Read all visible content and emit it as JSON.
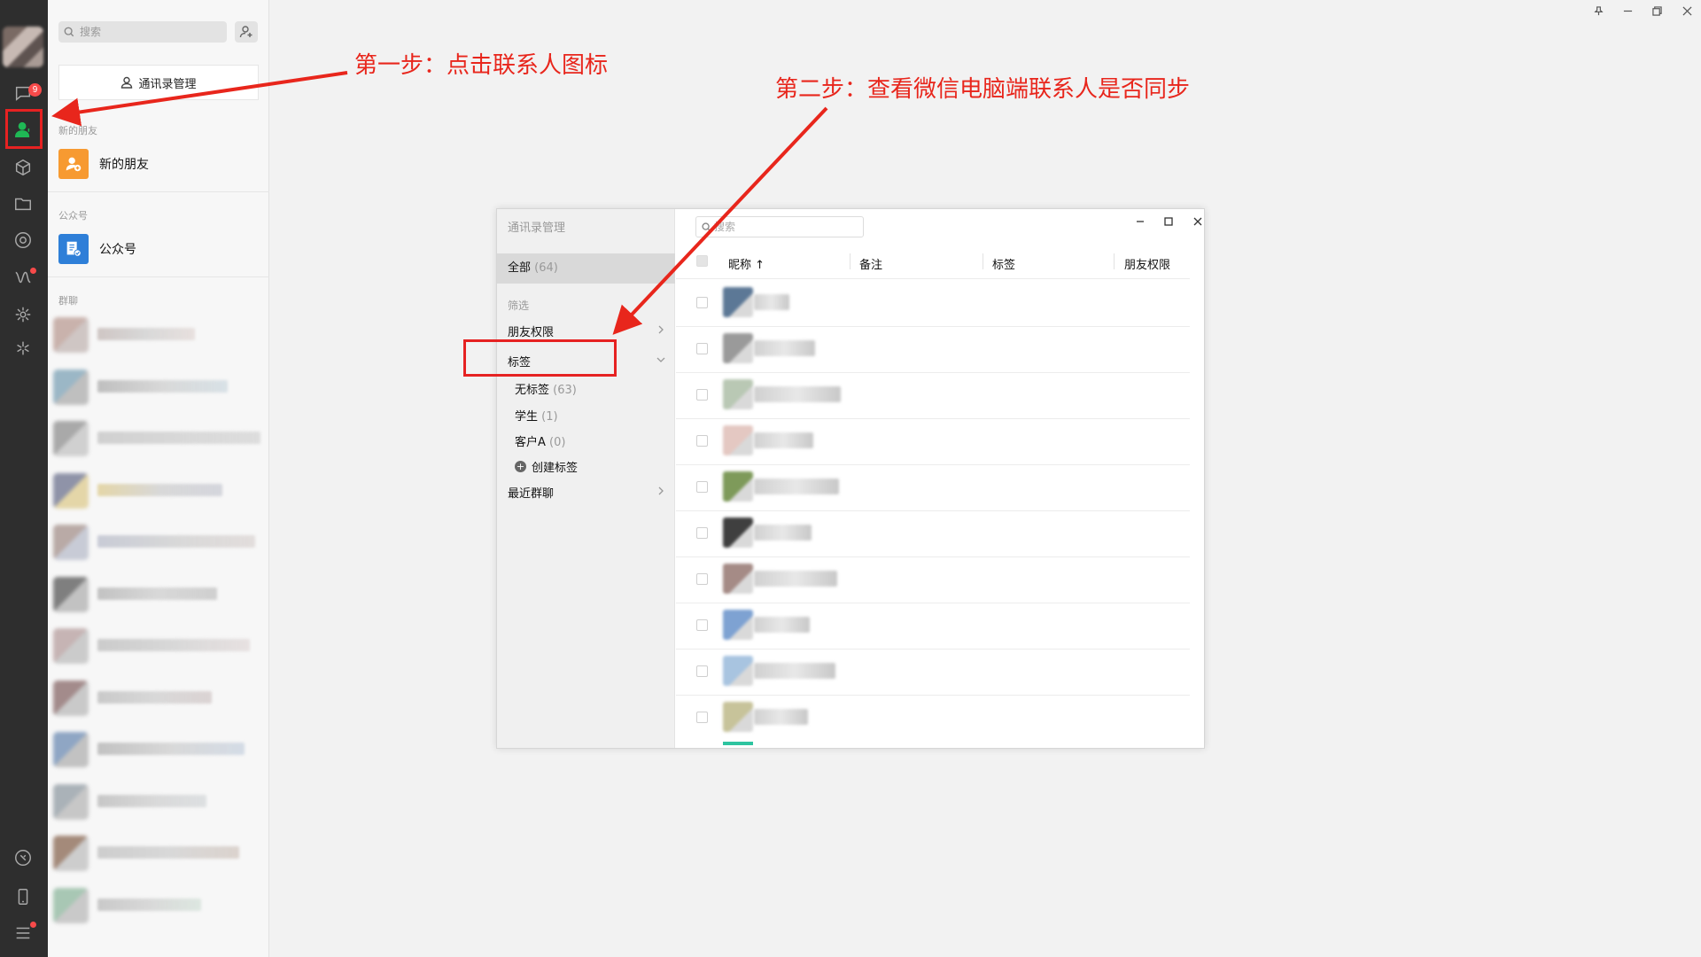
{
  "nav": {
    "unread_badge": "9",
    "icons": [
      "chat-icon",
      "contacts-icon",
      "favorites-icon",
      "files-icon",
      "moments-icon",
      "channels-icon",
      "mini-program-icon",
      "search-discover-icon",
      "phone-icon",
      "mobile-icon",
      "menu-icon"
    ]
  },
  "contacts_panel": {
    "search_placeholder": "搜索",
    "manage_button": "通讯录管理",
    "new_friends_section": "新的朋友",
    "new_friends_item": "新的朋友",
    "official_section": "公众号",
    "official_item": "公众号",
    "groups_section": "群聊"
  },
  "annotations": {
    "step1": "第一步：点击联系人图标",
    "step2": "第二步：查看微信电脑端联系人是否同步"
  },
  "manager_window": {
    "title": "通讯录管理",
    "all_label": "全部",
    "all_count": "(64)",
    "filter_label": "筛选",
    "friend_permission": "朋友权限",
    "tags": "标签",
    "no_tag_label": "无标签",
    "no_tag_count": "(63)",
    "student_label": "学生",
    "student_count": "(1)",
    "client_label": "客户A",
    "client_count": "(0)",
    "create_tag": "创建标签",
    "recent_groups": "最近群聊",
    "search_placeholder": "搜索",
    "columns": {
      "nickname": "昵称 ↑",
      "remark": "备注",
      "tag": "标签",
      "permission": "朋友权限"
    }
  }
}
